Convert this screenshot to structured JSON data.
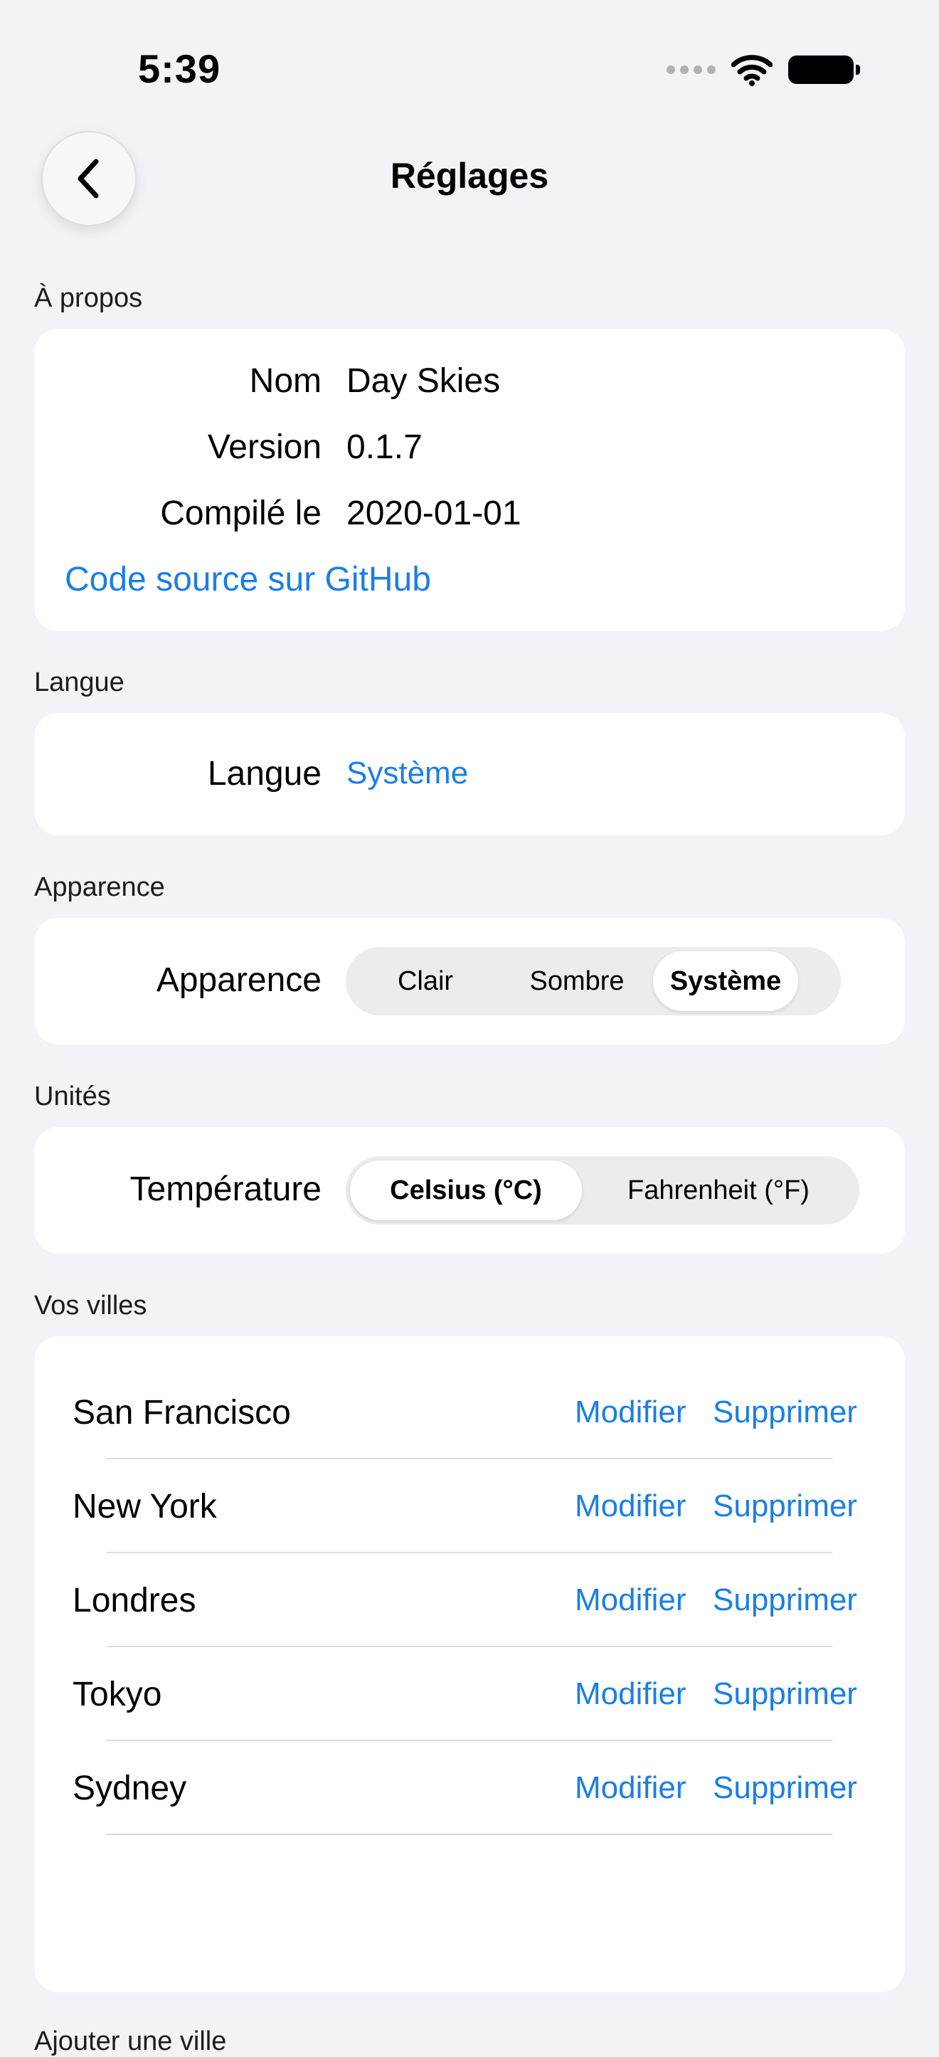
{
  "status_bar": {
    "time": "5:39"
  },
  "nav": {
    "title": "Réglages",
    "back_icon": "chevron-left-icon"
  },
  "about": {
    "header": "À propos",
    "rows": [
      {
        "label": "Nom",
        "value": "Day Skies"
      },
      {
        "label": "Version",
        "value": "0.1.7"
      },
      {
        "label": "Compilé le",
        "value": "2020-01-01"
      }
    ],
    "source_link": "Code source sur GitHub"
  },
  "language": {
    "header": "Langue",
    "label": "Langue",
    "value": "Système"
  },
  "appearance": {
    "header": "Apparence",
    "label": "Apparence",
    "options": [
      "Clair",
      "Sombre",
      "Système"
    ],
    "selected": "Système"
  },
  "units": {
    "header": "Unités",
    "label": "Température",
    "options": [
      "Celsius (°C)",
      "Fahrenheit (°F)"
    ],
    "selected": "Celsius (°C)"
  },
  "cities": {
    "header": "Vos villes",
    "edit_label": "Modifier",
    "delete_label": "Supprimer",
    "items": [
      "San Francisco",
      "New York",
      "Londres",
      "Tokyo",
      "Sydney"
    ]
  },
  "add_city": {
    "header": "Ajouter une ville"
  },
  "colors": {
    "accent": "#1a7ee8",
    "background": "#f2f2f7",
    "card": "#ffffff"
  }
}
